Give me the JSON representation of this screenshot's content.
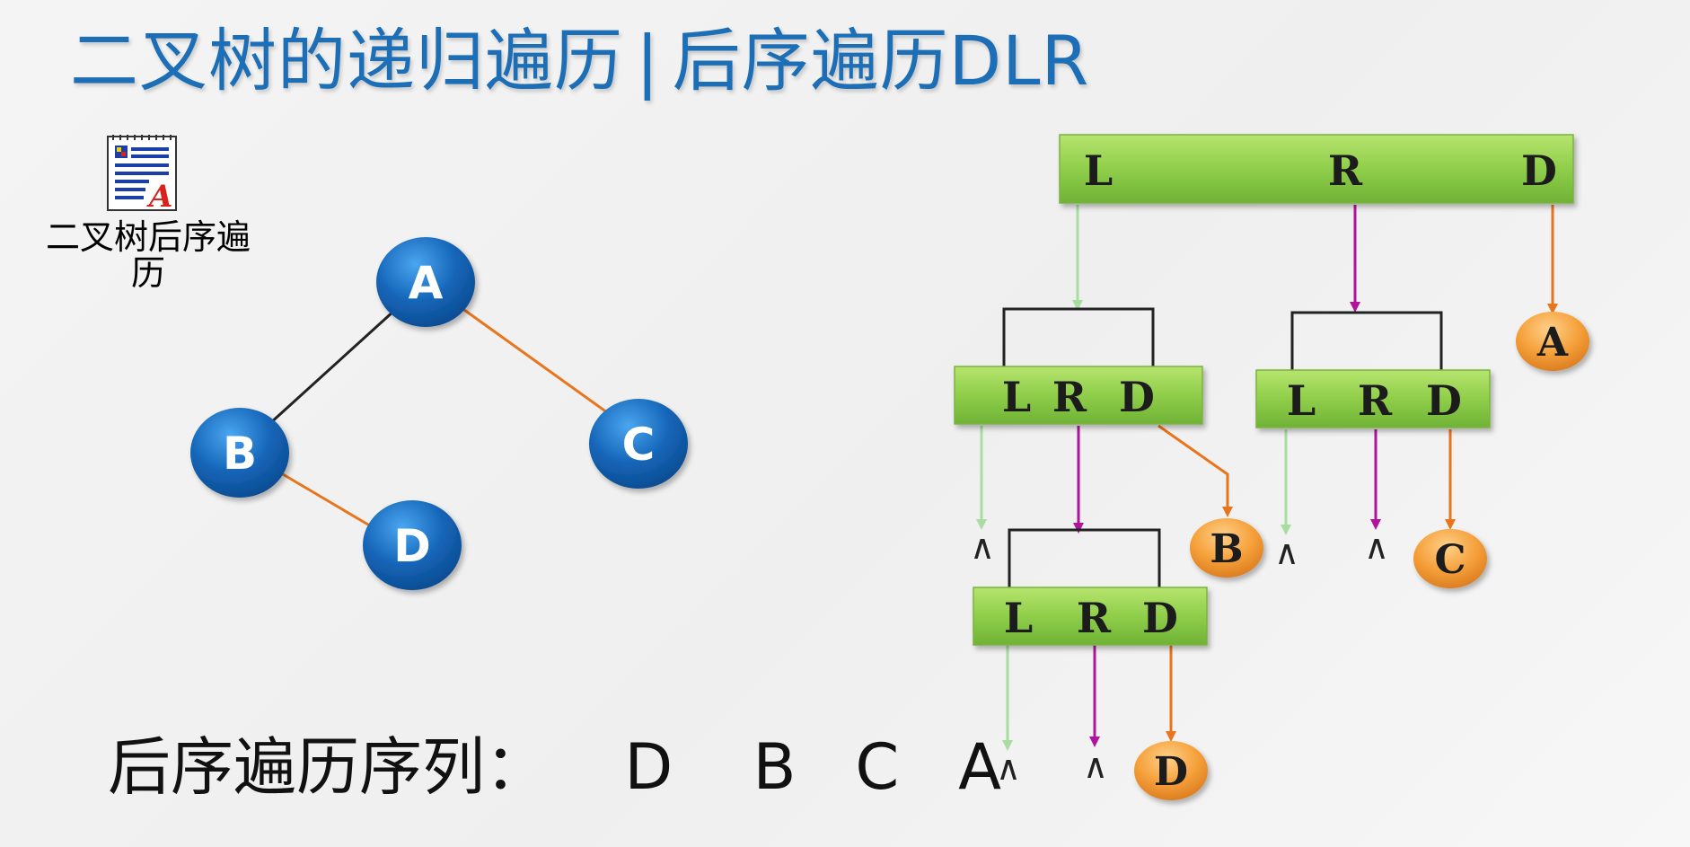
{
  "title": {
    "main": "二叉树的递归遍历",
    "separator": "|",
    "sub": "后序遍历DLR"
  },
  "embedded_doc": {
    "icon": "word-document-icon",
    "label_line1": "二叉树后序遍",
    "label_line2": "历"
  },
  "tree": {
    "nodes": [
      "A",
      "B",
      "C",
      "D"
    ],
    "edges": [
      [
        "A",
        "B"
      ],
      [
        "A",
        "C"
      ],
      [
        "B",
        "D"
      ]
    ]
  },
  "traversal_diagram": {
    "box_labels": {
      "L": "L",
      "R": "R",
      "D": "D"
    },
    "visited": [
      "A",
      "B",
      "C",
      "D"
    ],
    "null_symbol": "∧"
  },
  "sequence": {
    "label": "后序遍历序列：",
    "items": [
      "D",
      "B",
      "C",
      "A"
    ]
  },
  "colors": {
    "title": "#1c6fb6",
    "node_blue": "#1565b8",
    "box_green": "#8fce4a",
    "leaf_orange": "#f5a03a",
    "arrow_green": "#a8dca0",
    "arrow_magenta": "#b0149c",
    "arrow_orange": "#e8741c"
  }
}
